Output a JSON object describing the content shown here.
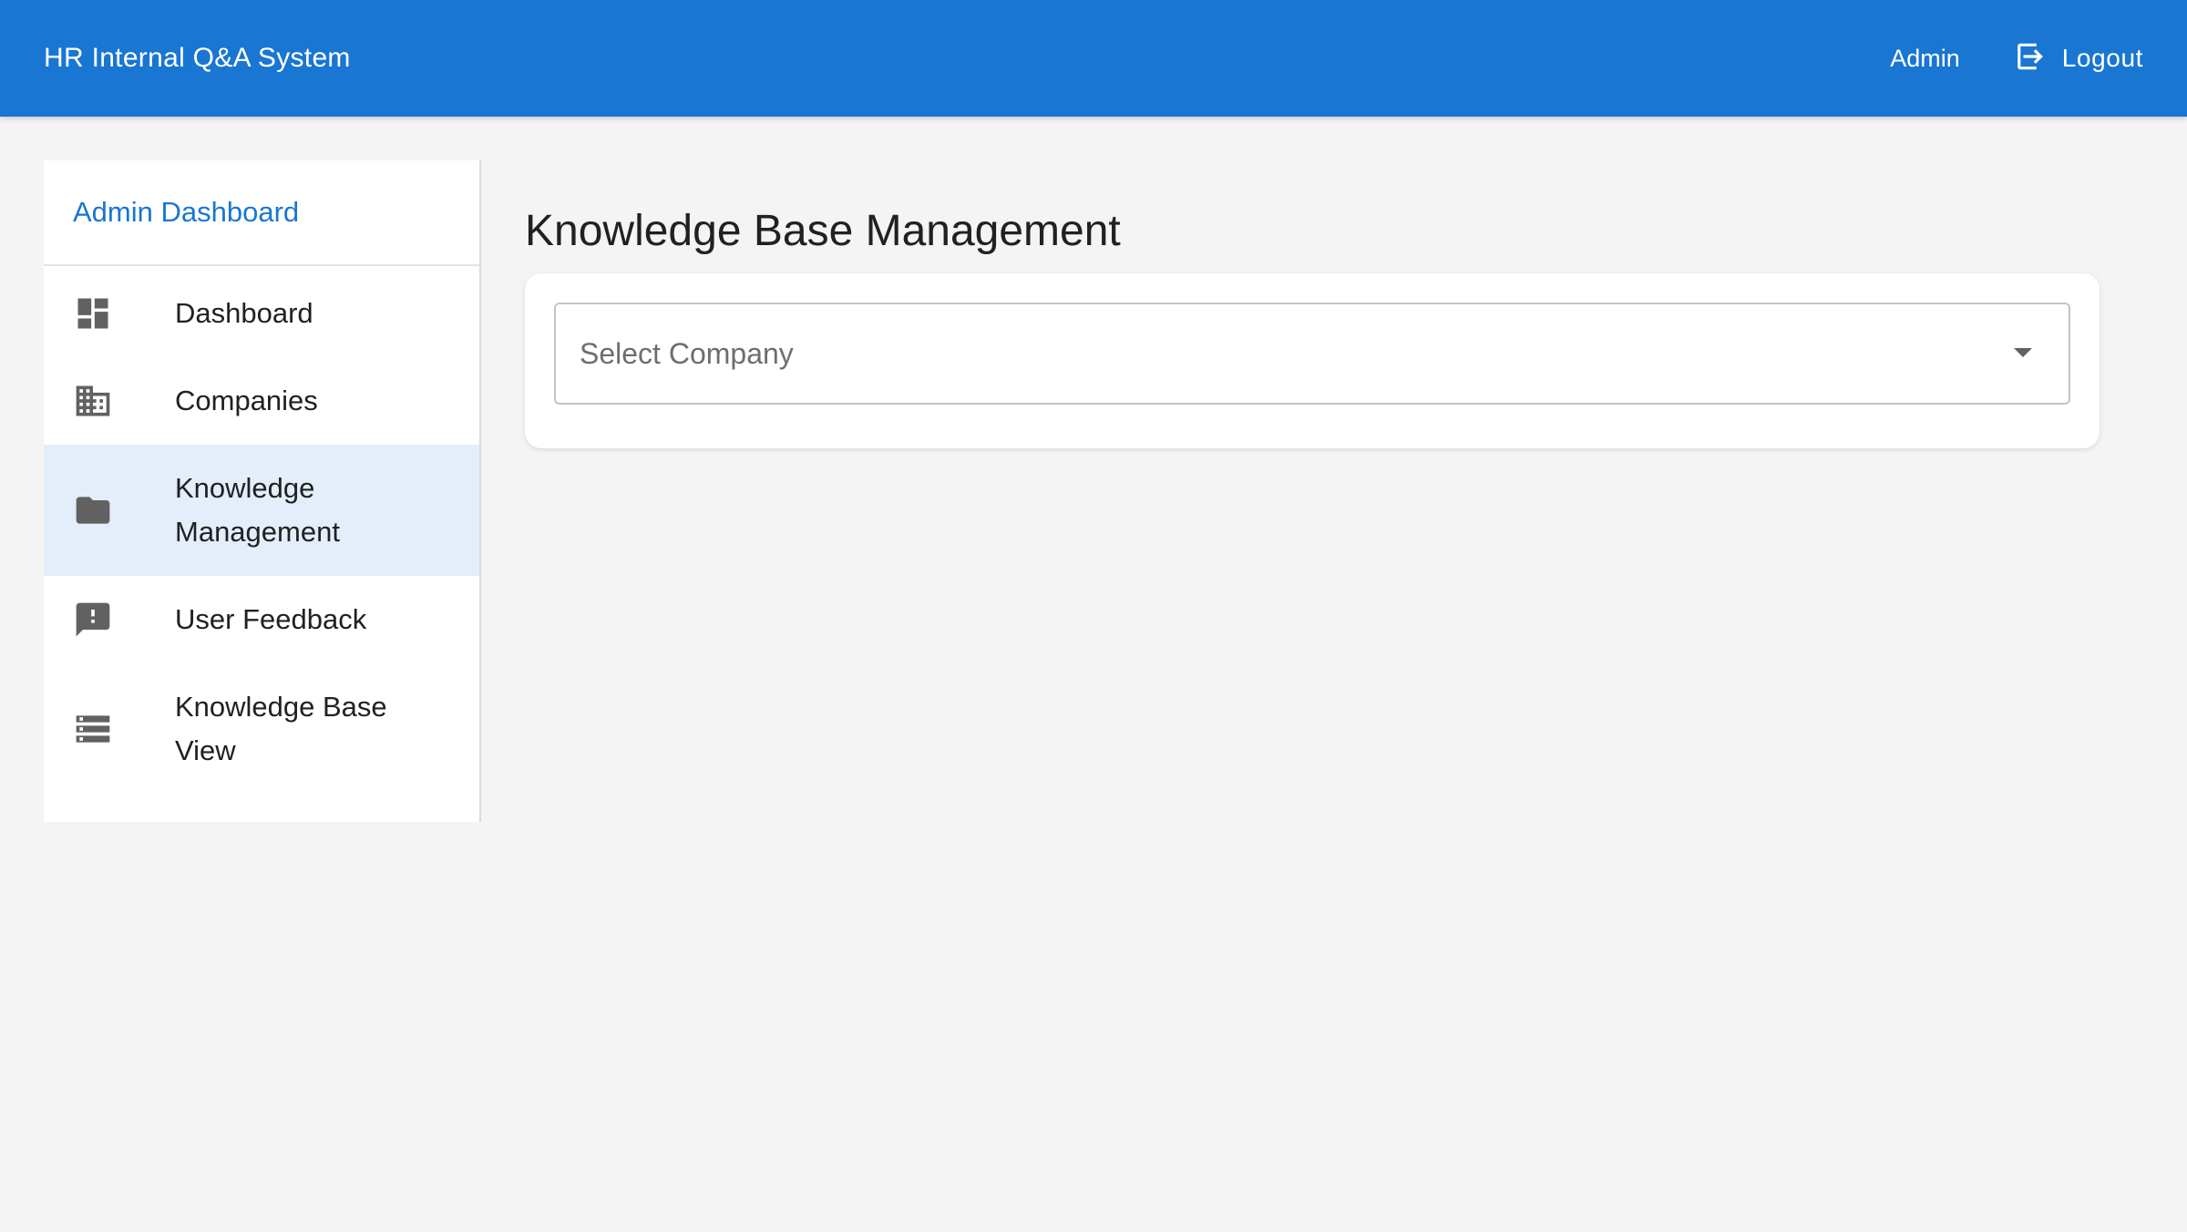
{
  "appbar": {
    "title": "HR Internal Q&A System",
    "user": "Admin",
    "logout_label": "Logout",
    "logout_icon": "logout-icon",
    "color": "#1976d2"
  },
  "sidebar": {
    "header": "Admin Dashboard",
    "items": [
      {
        "label": "Dashboard",
        "icon": "dashboard-icon",
        "active": false
      },
      {
        "label": "Companies",
        "icon": "business-icon",
        "active": false
      },
      {
        "label": "Knowledge Management",
        "icon": "folder-icon",
        "active": true
      },
      {
        "label": "User Feedback",
        "icon": "feedback-icon",
        "active": false
      },
      {
        "label": "Knowledge Base View",
        "icon": "storage-icon",
        "active": false
      }
    ],
    "active_bg": "#e3eefa",
    "accent": "#1976d2"
  },
  "main": {
    "title": "Knowledge Base Management",
    "company_select": {
      "placeholder": "Select Company",
      "value": ""
    }
  }
}
